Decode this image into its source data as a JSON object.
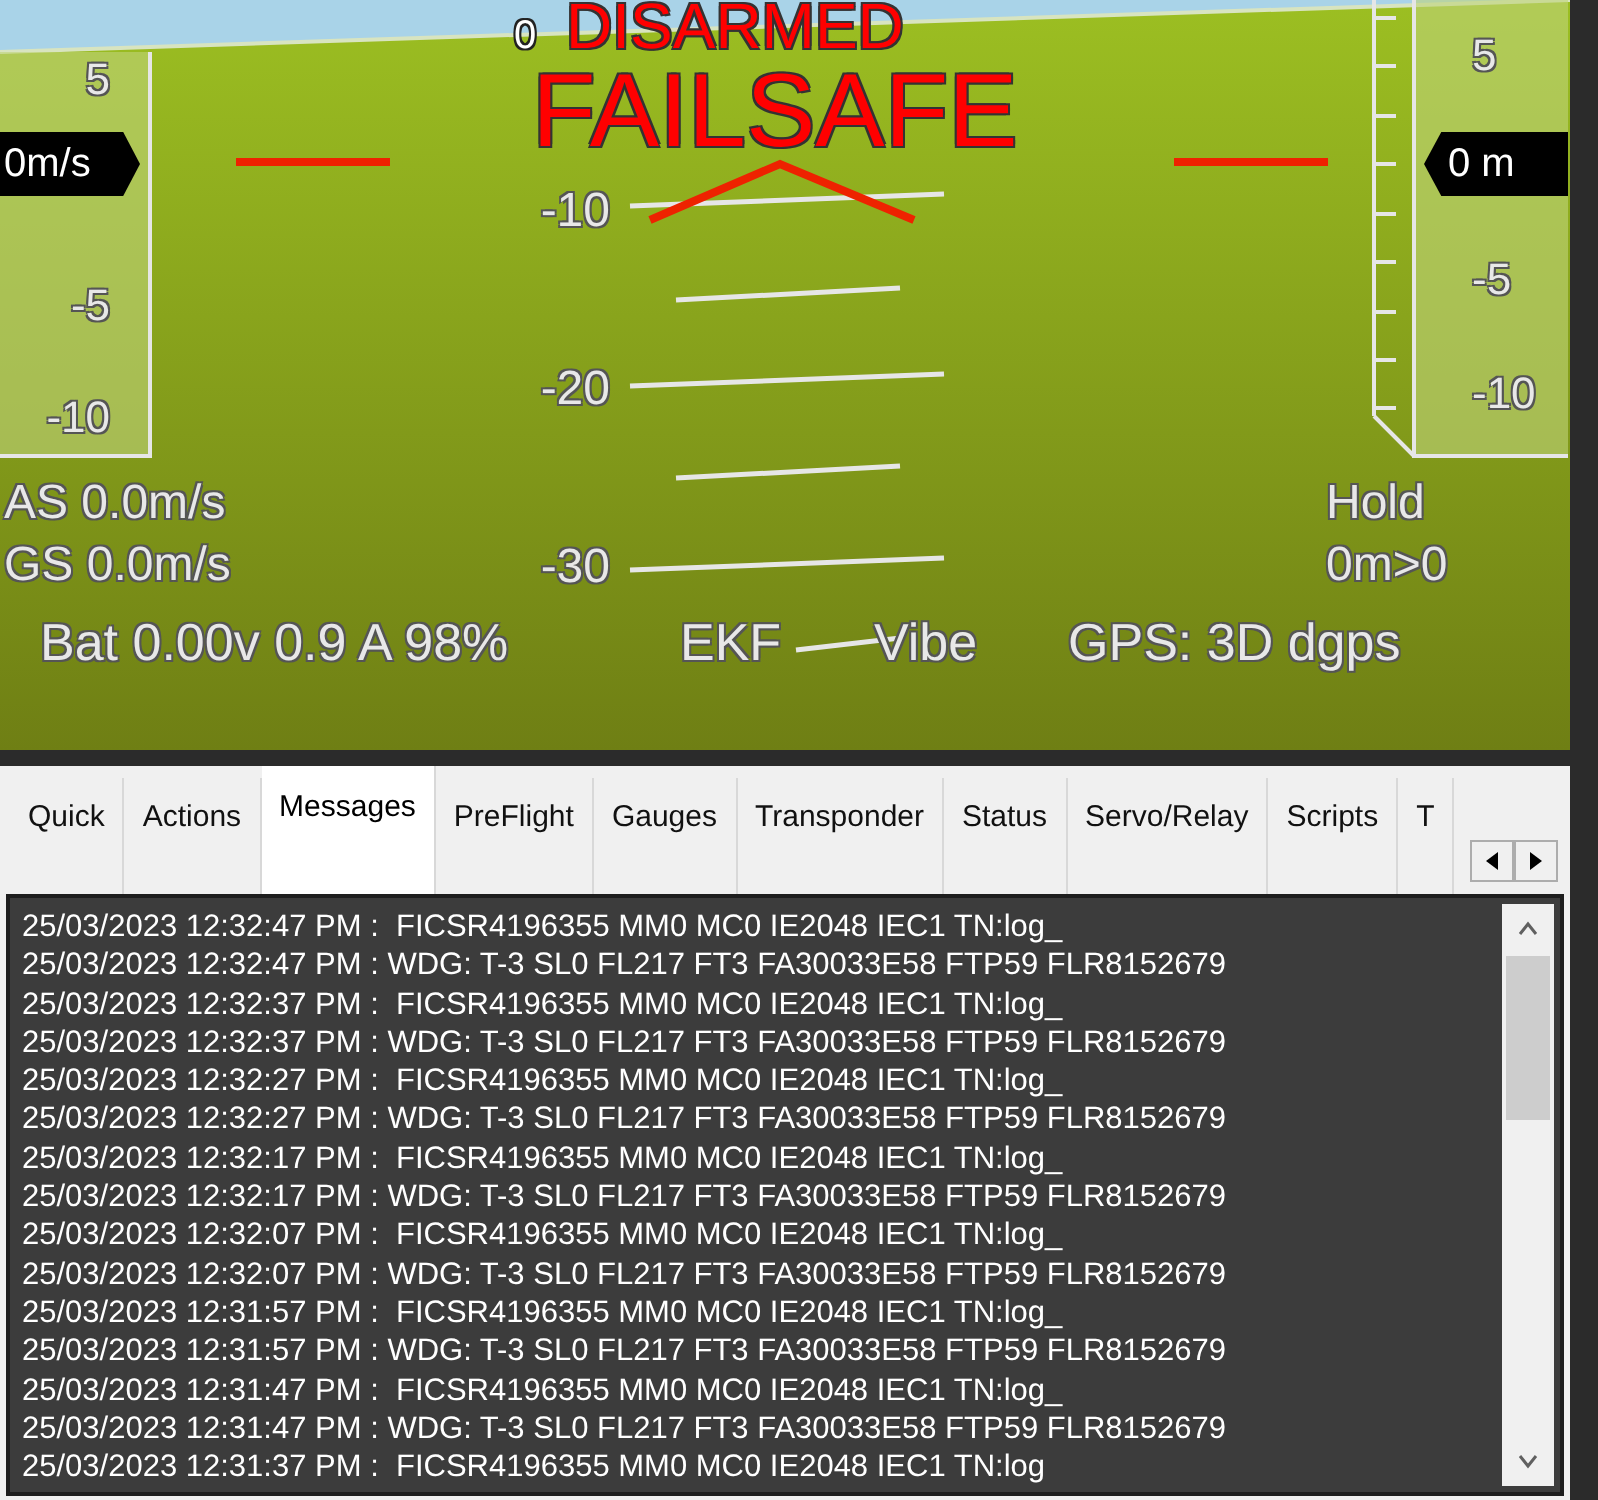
{
  "hud": {
    "status": "DISARMED",
    "warning": "FAILSAFE",
    "pitch_labels": [
      "0",
      "-10",
      "-20",
      "-30"
    ],
    "speed_tape": {
      "labels": [
        "5",
        "-5",
        "-10"
      ],
      "readout": "0m/s"
    },
    "altitude_tape": {
      "labels": [
        "5",
        "-5",
        "-10"
      ],
      "readout": "0 m"
    },
    "airspeed": "AS 0.0m/s",
    "groundspeed": "GS 0.0m/s",
    "mode": "Hold",
    "waypoint": "0m>0",
    "battery": "Bat 0.00v 0.9 A 98%",
    "ekf": "EKF",
    "vibe": "Vibe",
    "gps": "GPS: 3D dgps"
  },
  "tabs": [
    {
      "label": "Quick",
      "selected": false
    },
    {
      "label": "Actions",
      "selected": false
    },
    {
      "label": "Messages",
      "selected": true
    },
    {
      "label": "PreFlight",
      "selected": false
    },
    {
      "label": "Gauges",
      "selected": false
    },
    {
      "label": "Transponder",
      "selected": false
    },
    {
      "label": "Status",
      "selected": false
    },
    {
      "label": "Servo/Relay",
      "selected": false
    },
    {
      "label": "Scripts",
      "selected": false
    },
    {
      "label": "T",
      "selected": false
    }
  ],
  "messages": [
    "25/03/2023 12:32:47 PM :  FICSR4196355 MM0 MC0 IE2048 IEC1 TN:log_",
    "25/03/2023 12:32:47 PM : WDG: T-3 SL0 FL217 FT3 FA30033E58 FTP59 FLR8152679",
    "25/03/2023 12:32:37 PM :  FICSR4196355 MM0 MC0 IE2048 IEC1 TN:log_",
    "25/03/2023 12:32:37 PM : WDG: T-3 SL0 FL217 FT3 FA30033E58 FTP59 FLR8152679",
    "25/03/2023 12:32:27 PM :  FICSR4196355 MM0 MC0 IE2048 IEC1 TN:log_",
    "25/03/2023 12:32:27 PM : WDG: T-3 SL0 FL217 FT3 FA30033E58 FTP59 FLR8152679",
    "25/03/2023 12:32:17 PM :  FICSR4196355 MM0 MC0 IE2048 IEC1 TN:log_",
    "25/03/2023 12:32:17 PM : WDG: T-3 SL0 FL217 FT3 FA30033E58 FTP59 FLR8152679",
    "25/03/2023 12:32:07 PM :  FICSR4196355 MM0 MC0 IE2048 IEC1 TN:log_",
    "25/03/2023 12:32:07 PM : WDG: T-3 SL0 FL217 FT3 FA30033E58 FTP59 FLR8152679",
    "25/03/2023 12:31:57 PM :  FICSR4196355 MM0 MC0 IE2048 IEC1 TN:log_",
    "25/03/2023 12:31:57 PM : WDG: T-3 SL0 FL217 FT3 FA30033E58 FTP59 FLR8152679",
    "25/03/2023 12:31:47 PM :  FICSR4196355 MM0 MC0 IE2048 IEC1 TN:log_",
    "25/03/2023 12:31:47 PM : WDG: T-3 SL0 FL217 FT3 FA30033E58 FTP59 FLR8152679",
    "25/03/2023 12:31:37 PM :  FICSR4196355 MM0 MC0 IE2048 IEC1 TN:log"
  ]
}
